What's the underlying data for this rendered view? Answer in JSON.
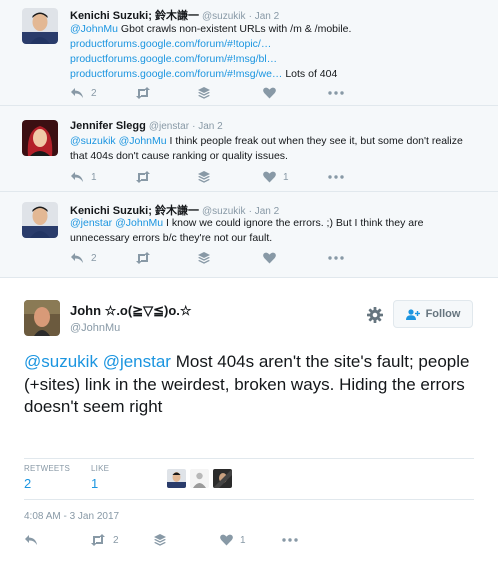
{
  "replies": [
    {
      "name": "Kenichi Suzuki; 鈴木謙一",
      "handle": "@suzukik",
      "time": "· Jan 2",
      "body": {
        "mention": "@JohnMu",
        "text1": " Gbot crawls non-existent URLs with /m & /mobile.",
        "link1": "productforums.google.com/forum/#!topic/…",
        "link2": "productforums.google.com/forum/#!msg/bl…",
        "link3": "productforums.google.com/forum/#!msg/we…",
        "text2": " Lots of 404"
      },
      "reply_count": "2",
      "like_count": ""
    },
    {
      "name": "Jennifer Slegg",
      "handle": "@jenstar",
      "time": "· Jan 2",
      "body": {
        "mention1": "@suzukik",
        "mention2": "@JohnMu",
        "text": " I think people freak out when they see it, but some don't realize that 404s don't cause ranking or quality issues."
      },
      "reply_count": "1",
      "like_count": "1"
    },
    {
      "name": "Kenichi Suzuki; 鈴木謙一",
      "handle": "@suzukik",
      "time": "· Jan 2",
      "body": {
        "mention1": "@jenstar",
        "mention2": "@JohnMu",
        "text": " I know we could ignore the errors. ;) But I think they are unnecessary errors b/c they're not our fault."
      },
      "reply_count": "2",
      "like_count": ""
    }
  ],
  "main": {
    "name": "John ☆.o(≧▽≦)o.☆",
    "handle": "@JohnMu",
    "follow_label": "Follow",
    "mention1": "@suzukik",
    "mention2": "@jenstar",
    "text": " Most 404s aren't the site's fault; people (+sites) link in the weirdest, broken ways. Hiding the errors doesn't seem right",
    "retweets_label": "RETWEETS",
    "retweets_value": "2",
    "likes_label": "LIKE",
    "likes_value": "1",
    "timestamp": "4:08 AM - 3 Jan 2017",
    "retweet_count": "2",
    "like_count": "1"
  },
  "colors": {
    "link": "#1b95e0",
    "muted": "#8899a6",
    "reply_bg": "#f5f8fa"
  }
}
